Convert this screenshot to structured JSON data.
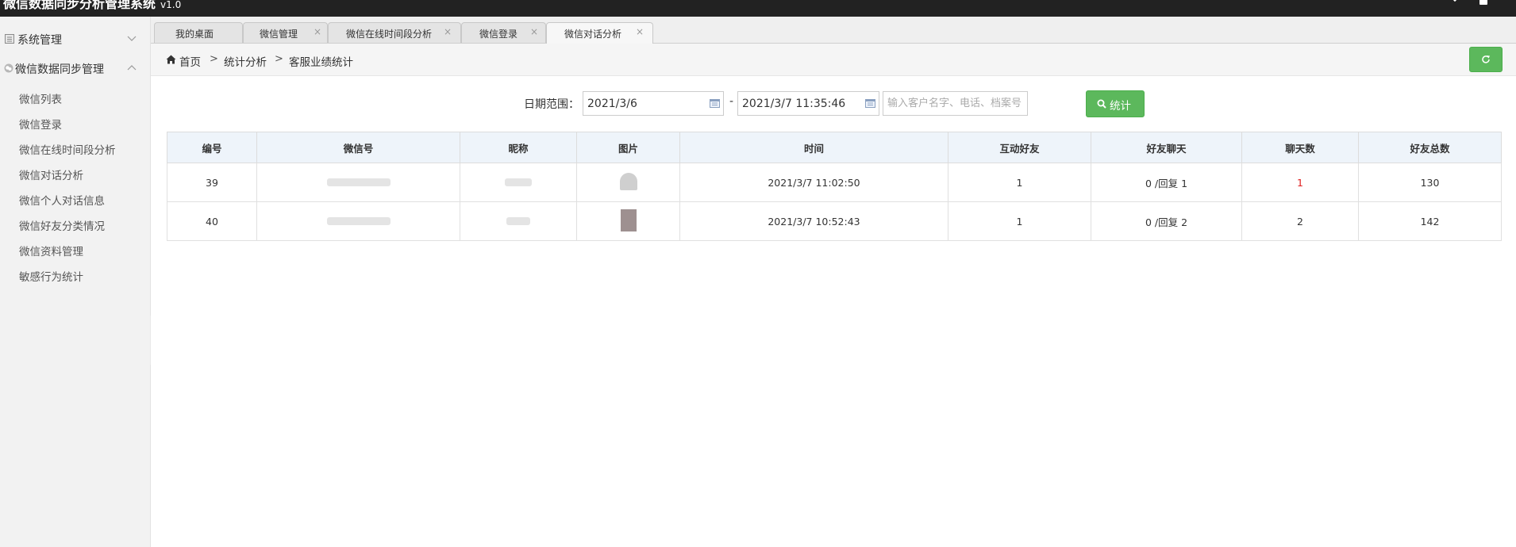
{
  "header": {
    "app_title": "微信数据同步分析管理系统",
    "version": "v1.0",
    "icons": [
      "chevron-down-icon",
      "user-icon"
    ]
  },
  "sidebar": {
    "groups": [
      {
        "label": "系统管理",
        "icon": "system-icon",
        "expanded": false
      },
      {
        "label": "微信数据同步管理",
        "icon": "wechat-icon",
        "expanded": true
      }
    ],
    "items": [
      {
        "label": "微信列表"
      },
      {
        "label": "微信登录"
      },
      {
        "label": "微信在线时间段分析"
      },
      {
        "label": "微信对话分析"
      },
      {
        "label": "微信个人对话信息"
      },
      {
        "label": "微信好友分类情况"
      },
      {
        "label": "微信资料管理"
      },
      {
        "label": "敏感行为统计"
      }
    ]
  },
  "tabs": [
    {
      "label": "我的桌面",
      "closable": false,
      "active": false
    },
    {
      "label": "微信管理",
      "closable": true,
      "active": false
    },
    {
      "label": "微信在线时间段分析",
      "closable": true,
      "active": false
    },
    {
      "label": "微信登录",
      "closable": true,
      "active": false
    },
    {
      "label": "微信对话分析",
      "closable": true,
      "active": true
    }
  ],
  "breadcrumb": {
    "items": [
      "首页",
      "统计分析",
      "客服业绩统计"
    ],
    "separator": ">"
  },
  "filter": {
    "date_label": "日期范围：",
    "start_date": "2021/3/6",
    "end_date": "2021/3/7 11:35:46",
    "range_separator": "-",
    "search_placeholder": "输入客户名字、电话、档案号",
    "search_value": "",
    "submit_label": "统计"
  },
  "table": {
    "columns": [
      "编号",
      "微信号",
      "昵称",
      "图片",
      "时间",
      "互动好友",
      "好友聊天",
      "聊天数",
      "好友总数"
    ],
    "rows": [
      {
        "id": "39",
        "wechat_id": "",
        "nickname": "",
        "time": "2021/3/7 11:02:50",
        "interactive_friends": "1",
        "friend_chat": "0 /回复 1",
        "chat_count": "1",
        "total_friends": "130"
      },
      {
        "id": "40",
        "wechat_id": "",
        "nickname": "",
        "time": "2021/3/7 10:52:43",
        "interactive_friends": "1",
        "friend_chat": "0 /回复 2",
        "chat_count": "2",
        "total_friends": "142"
      }
    ]
  },
  "colors": {
    "header_bg": "#222222",
    "success": "#5cb85c",
    "highlight_red": "#e02020",
    "table_header_bg": "#eef4fa"
  }
}
